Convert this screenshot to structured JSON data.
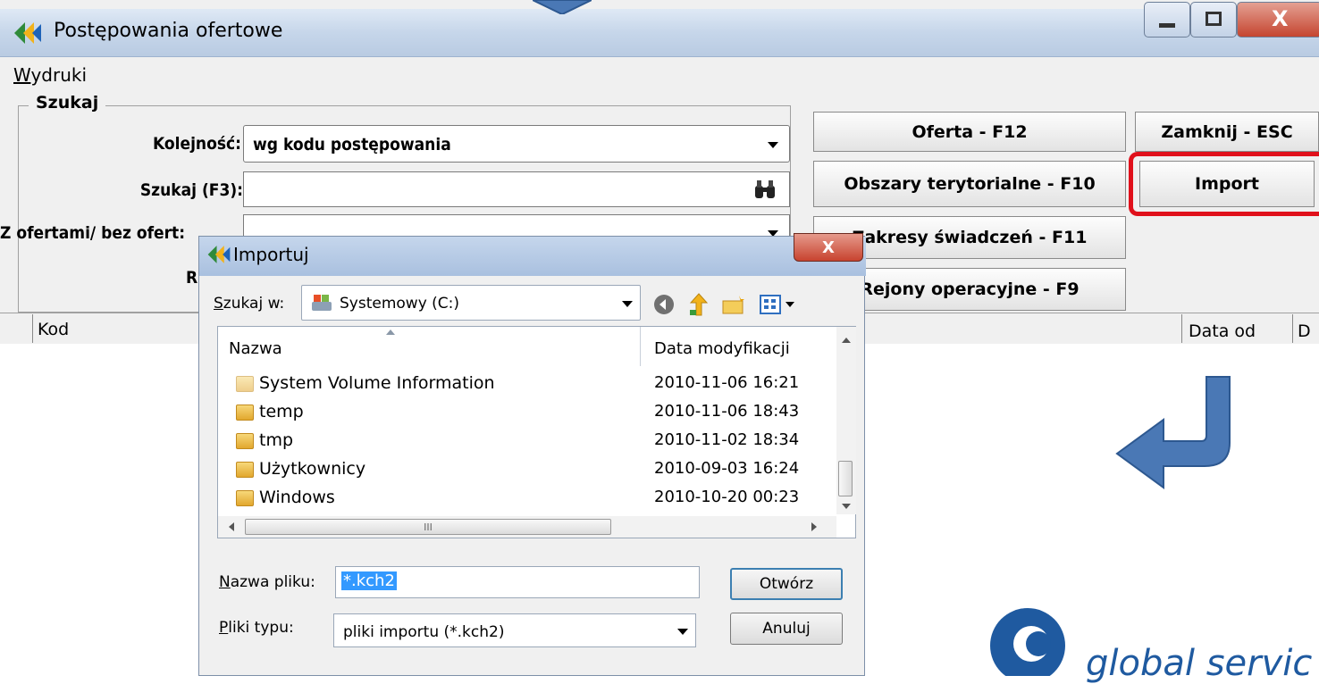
{
  "main_window": {
    "title": "Postępowania ofertowe",
    "menu": {
      "wydruki_accel": "W",
      "wydruki_rest": "ydruki"
    },
    "search": {
      "legend": "Szukaj",
      "order_label": "Kolejność:",
      "order_value": "wg kodu postępowania",
      "search_label": "Szukaj (F3):",
      "search_value": "",
      "offers_label": "Z ofertami/ bez ofert:",
      "offers_value": "",
      "partial_label": "R"
    },
    "buttons": {
      "oferta": "Oferta - F12",
      "zamknij": "Zamknij - ESC",
      "obszary": "Obszary terytorialne - F10",
      "import": "Import",
      "zakresy": "Zakresy świadczeń - F11",
      "rejony": "Rejony operacyjne - F9"
    },
    "columns": {
      "kod": "Kod",
      "data_od": "Data od",
      "d": "D"
    }
  },
  "dialog": {
    "title": "Importuj",
    "look_in_label_accel": "S",
    "look_in_label_rest": "zukaj w:",
    "look_in_value": "Systemowy (C:)",
    "col_name": "Nazwa",
    "col_modified": "Data modyfikacji",
    "files": [
      {
        "name": "System Volume Information",
        "modified": "2010-11-06 16:21"
      },
      {
        "name": "temp",
        "modified": "2010-11-06 18:43"
      },
      {
        "name": "tmp",
        "modified": "2010-11-02 18:34"
      },
      {
        "name": "Użytkownicy",
        "modified": "2010-09-03 16:24"
      },
      {
        "name": "Windows",
        "modified": "2010-10-20 00:23"
      }
    ],
    "filename_label_accel": "N",
    "filename_label_rest": "azwa pliku:",
    "filename_value": "*.kch2",
    "filetype_label_accel": "P",
    "filetype_label_rest": "liki typu:",
    "filetype_value": "pliki importu (*.kch2)",
    "open_button": "Otwórz",
    "cancel_button": "Anuluj",
    "scroll_glyph": "III"
  },
  "logo": {
    "text": "global servic"
  },
  "colors": {
    "arrow": "#4a78b5",
    "highlight": "#e0101b",
    "logo": "#1f5aa0"
  }
}
